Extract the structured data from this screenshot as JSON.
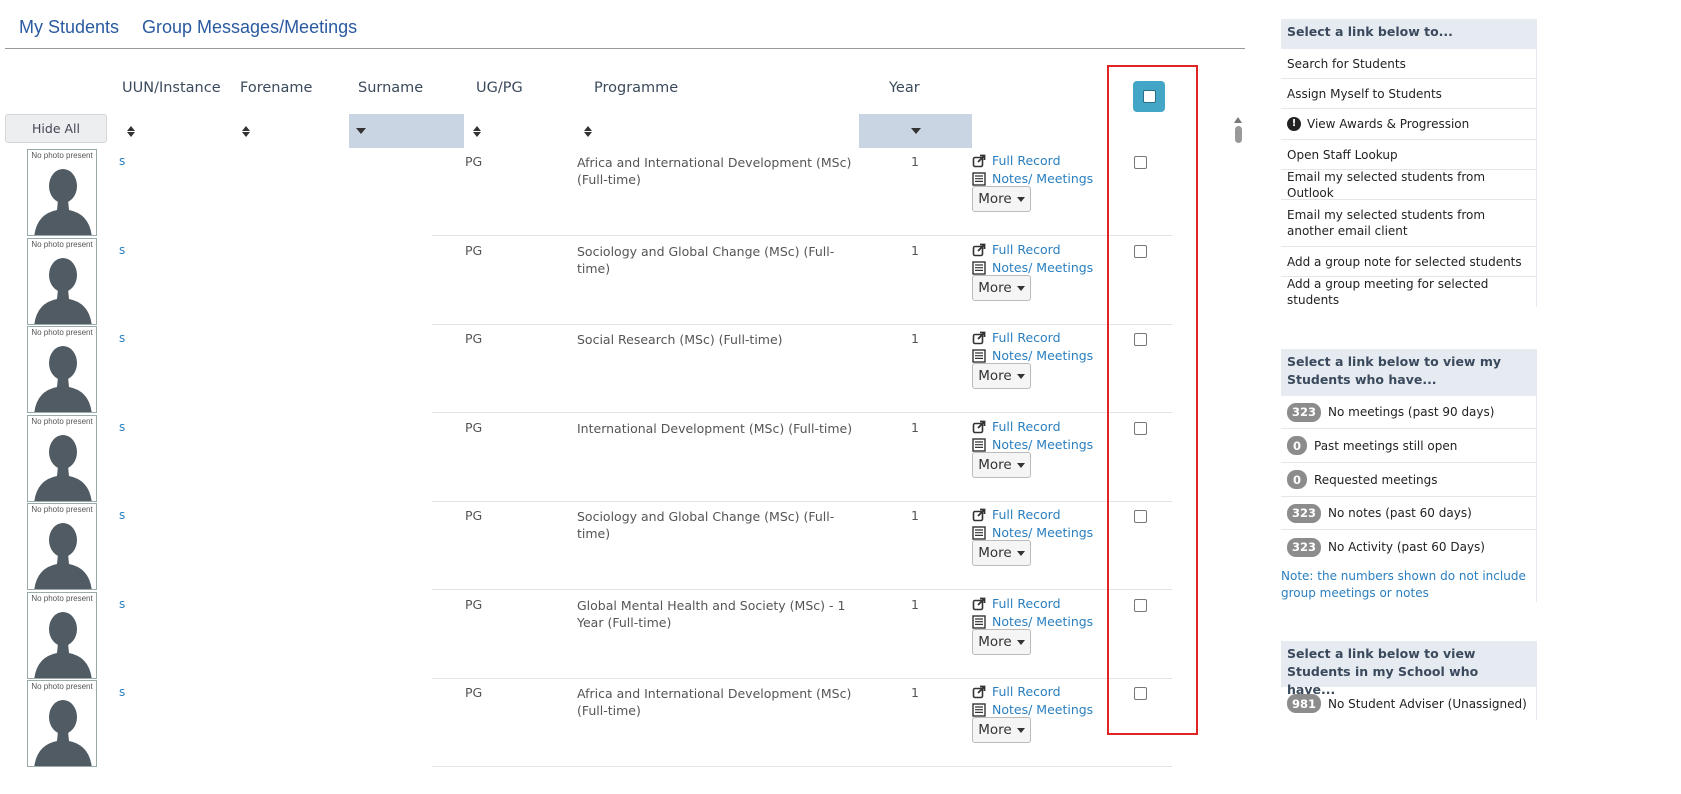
{
  "tabs": [
    {
      "label": "My Students"
    },
    {
      "label": "Group Messages/Meetings"
    }
  ],
  "table": {
    "hide_all_label": "Hide All",
    "columns": {
      "uun": "UUN/Instance",
      "forename": "Forename",
      "surname": "Surname",
      "ugpg": "UG/PG",
      "programme": "Programme",
      "year": "Year"
    },
    "photo_label": "No photo present",
    "full_record_label": "Full Record",
    "notes_label": "Notes/ Meetings",
    "more_label": "More",
    "rows": [
      {
        "uun": "s",
        "ugpg": "PG",
        "programme": "Africa and International Development (MSc) (Full-time)",
        "year": "1"
      },
      {
        "uun": "s",
        "ugpg": "PG",
        "programme": "Sociology and Global Change (MSc) (Full-time)",
        "year": "1"
      },
      {
        "uun": "s",
        "ugpg": "PG",
        "programme": "Social Research (MSc) (Full-time)",
        "year": "1"
      },
      {
        "uun": "s",
        "ugpg": "PG",
        "programme": "International Development (MSc) (Full-time)",
        "year": "1"
      },
      {
        "uun": "s",
        "ugpg": "PG",
        "programme": "Sociology and Global Change (MSc) (Full-time)",
        "year": "1"
      },
      {
        "uun": "s",
        "ugpg": "PG",
        "programme": "Global Mental Health and Society (MSc) - 1 Year (Full-time)",
        "year": "1"
      },
      {
        "uun": "s",
        "ugpg": "PG",
        "programme": "Africa and International Development (MSc) (Full-time)",
        "year": "1"
      }
    ]
  },
  "panel1": {
    "title": "Select a link below to...",
    "items": [
      {
        "label": "Search for Students"
      },
      {
        "label": "Assign Myself to Students"
      },
      {
        "label": "View Awards & Progression"
      },
      {
        "label": "Open Staff Lookup"
      },
      {
        "label": "Email my selected students from Outlook"
      },
      {
        "label": "Email my selected students from another email client"
      },
      {
        "label": "Add a group note for selected students"
      },
      {
        "label": "Add a group meeting for selected students"
      }
    ]
  },
  "panel2": {
    "title": "Select a link below to view my Students who have...",
    "items": [
      {
        "count": "323",
        "label": "No meetings (past 90 days)"
      },
      {
        "count": "0",
        "label": "Past meetings still open"
      },
      {
        "count": "0",
        "label": "Requested meetings"
      },
      {
        "count": "323",
        "label": "No notes (past 60 days)"
      },
      {
        "count": "323",
        "label": "No Activity (past 60 Days)"
      }
    ],
    "note": "Note: the numbers shown do not include group meetings or notes"
  },
  "panel3": {
    "title": "Select a link below to view Students in my School who have...",
    "items": [
      {
        "count": "981",
        "label": "No Student Adviser (Unassigned)"
      }
    ]
  },
  "colors": {
    "link": "#2a7fc0",
    "tab": "#2a5aa0",
    "select_all": "#44a6c6",
    "highlight": "#e02424",
    "badge": "#8c8c8c",
    "panel_header": "#e6ebf2"
  }
}
